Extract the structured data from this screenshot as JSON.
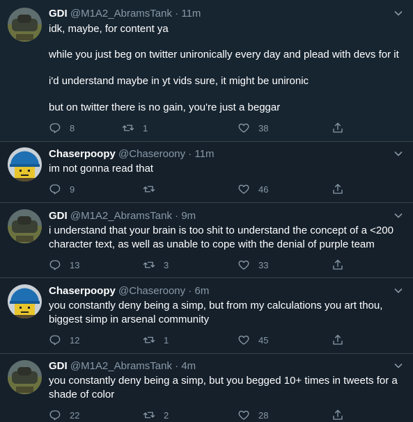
{
  "tweets": [
    {
      "name": "GDI",
      "handle": "@M1A2_AbramsTank",
      "time": "11m",
      "avatar": "tank-avatar",
      "lines": [
        "idk, maybe, for content ya",
        "while you just beg on twitter unironically every day and plead with devs for it",
        "i'd understand maybe in yt vids sure, it might be unironic",
        "but on twitter there is no gain, you're just a beggar"
      ],
      "reply_count": "8",
      "retweet_count": "1",
      "like_count": "38"
    },
    {
      "name": "Chaserpoopy",
      "handle": "@Chaseroony",
      "time": "11m",
      "avatar": "blue-helmet-avatar",
      "lines": [
        "im not gonna read that"
      ],
      "reply_count": "9",
      "retweet_count": "",
      "like_count": "46"
    },
    {
      "name": "GDI",
      "handle": "@M1A2_AbramsTank",
      "time": "9m",
      "avatar": "tank-avatar",
      "lines": [
        "i understand that your brain is too shit to understand the concept of a <200 character text, as well as unable to cope with the denial of purple team"
      ],
      "reply_count": "13",
      "retweet_count": "3",
      "like_count": "33"
    },
    {
      "name": "Chaserpoopy",
      "handle": "@Chaseroony",
      "time": "6m",
      "avatar": "blue-helmet-avatar",
      "lines": [
        "you constantly deny being a simp, but from my calculations you art thou, biggest simp in arsenal community"
      ],
      "reply_count": "12",
      "retweet_count": "1",
      "like_count": "45"
    },
    {
      "name": "GDI",
      "handle": "@M1A2_AbramsTank",
      "time": "4m",
      "avatar": "tank-avatar",
      "lines": [
        "you constantly deny being a simp, but you begged 10+ times in tweets for a shade of color"
      ],
      "reply_count": "22",
      "retweet_count": "2",
      "like_count": "28"
    }
  ],
  "separator": " · ",
  "colors": {
    "background": "#15202b",
    "muted": "#8899a6",
    "divider": "#38444d"
  }
}
